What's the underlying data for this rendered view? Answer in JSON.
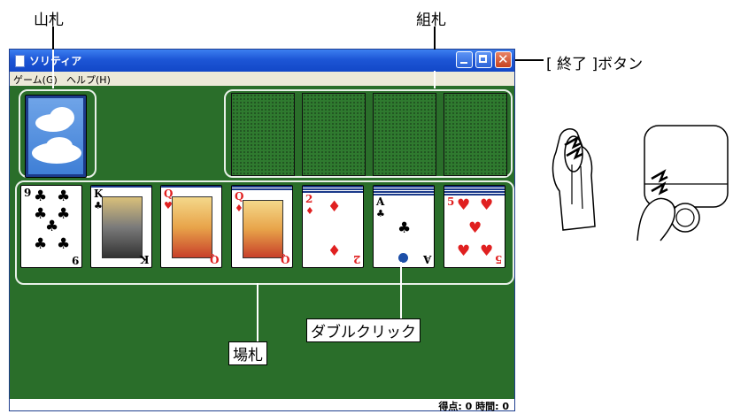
{
  "callouts": {
    "stock": "山札",
    "foundation": "組札",
    "close": "[ 終了 ]ボタン",
    "tableau": "場札",
    "double_click": "ダブルクリック"
  },
  "window": {
    "title": "ソリティア",
    "menu": [
      "ゲーム(G)",
      "ヘルプ(H)"
    ],
    "status": "得点: 0 時間: 0"
  },
  "tableau": [
    {
      "rank": "9",
      "suit": "♣",
      "color": "black"
    },
    {
      "rank": "K",
      "suit": "♣",
      "color": "black"
    },
    {
      "rank": "Q",
      "suit": "♥",
      "color": "red"
    },
    {
      "rank": "Q",
      "suit": "♦",
      "color": "red"
    },
    {
      "rank": "2",
      "suit": "♦",
      "color": "red"
    },
    {
      "rank": "A",
      "suit": "♣",
      "color": "black"
    },
    {
      "rank": "5",
      "suit": "♥",
      "color": "red"
    }
  ],
  "colors": {
    "felt": "#2a6e2a",
    "titlebar": "#1d56d6",
    "close": "#c8421e"
  }
}
